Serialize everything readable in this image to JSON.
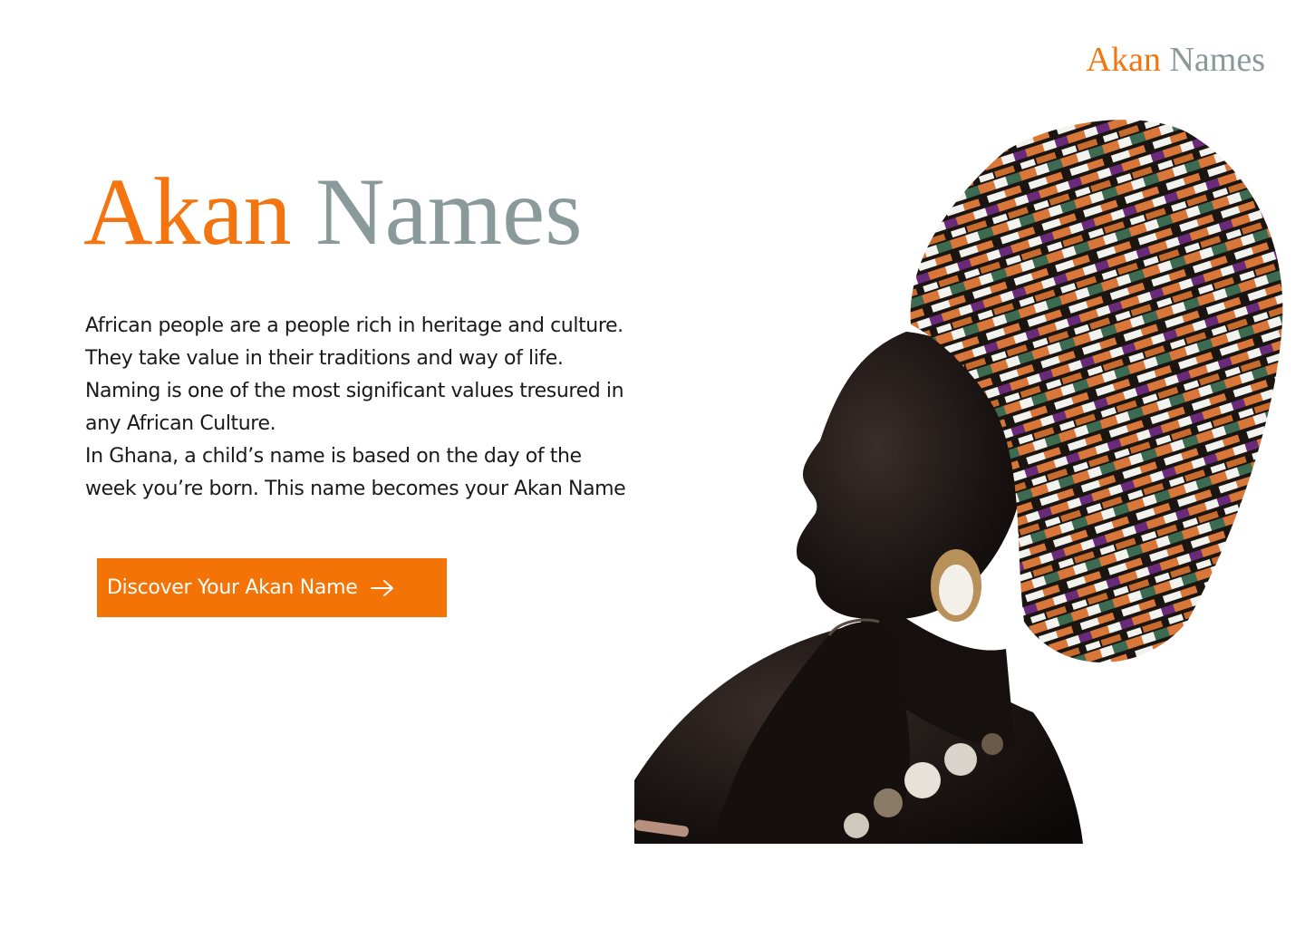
{
  "header": {
    "logo_word1": "Akan",
    "logo_word2": "Names"
  },
  "hero": {
    "title_word1": "Akan",
    "title_word2": "Names",
    "intro_lines": [
      "African people are a people rich in heritage and culture.",
      "They take value in their traditions and way of life.",
      "Naming is one of the most significant values tresured in",
      "any African Culture.",
      "In Ghana, a child’s name is based on the day of the",
      "week you’re born. This name becomes your Akan Name"
    ],
    "cta_label": "Discover Your Akan Name",
    "cta_icon": "arrow-right-icon"
  },
  "image": {
    "subject": "woman-in-kente-headwrap-profile"
  },
  "colors": {
    "accent": "#f47510",
    "muted": "#8a9a9a",
    "text": "#1a1a1a",
    "button": "#f47306"
  }
}
